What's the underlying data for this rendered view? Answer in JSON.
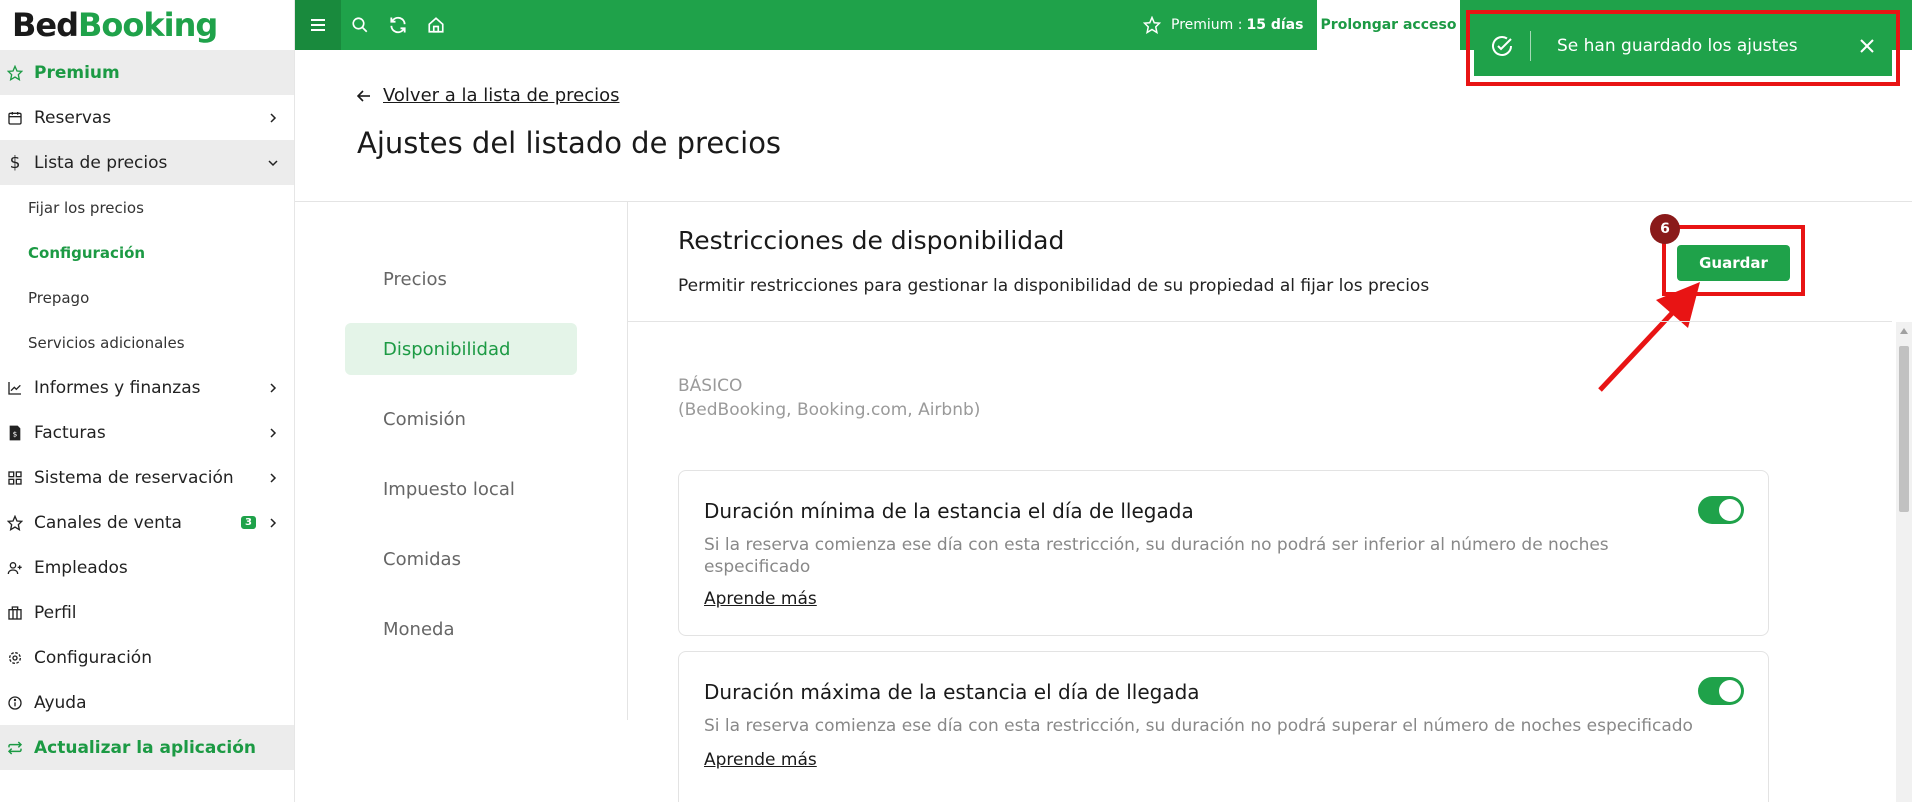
{
  "brand": {
    "part1": "Bed",
    "part2": "Booking"
  },
  "sidebar": {
    "items": [
      {
        "label": "Premium",
        "icon": "star-icon",
        "name": "sidebar-item-premium"
      },
      {
        "label": "Reservas",
        "icon": "calendar-icon",
        "name": "sidebar-item-reservas"
      },
      {
        "label": "Lista de precios",
        "icon": "dollar-icon",
        "name": "sidebar-item-lista-de-precios"
      },
      {
        "label": "Fijar los precios",
        "name": "sidebar-sub-fijar-precios"
      },
      {
        "label": "Configuración",
        "name": "sidebar-sub-configuracion"
      },
      {
        "label": "Prepago",
        "name": "sidebar-sub-prepago"
      },
      {
        "label": "Servicios adicionales",
        "name": "sidebar-sub-servicios-adicionales"
      },
      {
        "label": "Informes y finanzas",
        "icon": "chart-icon",
        "name": "sidebar-item-informes"
      },
      {
        "label": "Facturas",
        "icon": "invoice-icon",
        "name": "sidebar-item-facturas"
      },
      {
        "label": "Sistema de reservación",
        "icon": "grid-icon",
        "name": "sidebar-item-sistema"
      },
      {
        "label": "Canales de venta",
        "icon": "star-icon",
        "badge": "3",
        "name": "sidebar-item-canales"
      },
      {
        "label": "Empleados",
        "icon": "user-add-icon",
        "name": "sidebar-item-empleados"
      },
      {
        "label": "Perfil",
        "icon": "building-icon",
        "name": "sidebar-item-perfil"
      },
      {
        "label": "Configuración",
        "icon": "gear-icon",
        "name": "sidebar-item-configuracion"
      },
      {
        "label": "Ayuda",
        "icon": "info-icon",
        "name": "sidebar-item-ayuda"
      },
      {
        "label": "Actualizar la aplicación",
        "icon": "refresh-icon",
        "name": "sidebar-item-actualizar"
      }
    ]
  },
  "topbar": {
    "premium_label": "Premium :",
    "premium_days": "15 días",
    "prolongar": "Prolongar acceso"
  },
  "toast": {
    "message": "Se han guardado los ajustes"
  },
  "header": {
    "back_link": "Volver a la lista de precios",
    "title": "Ajustes del listado de precios"
  },
  "subnav": [
    "Precios",
    "Disponibilidad",
    "Comisión",
    "Impuesto local",
    "Comidas",
    "Moneda"
  ],
  "section": {
    "title": "Restricciones de disponibilidad",
    "description": "Permitir restricciones para gestionar la disponibilidad de su propiedad al fijar los precios",
    "save_label": "Guardar",
    "step_number": "6"
  },
  "group": {
    "label": "BÁSICO",
    "channels": "(BedBooking, Booking.com, Airbnb)"
  },
  "cards": [
    {
      "title": "Duración mínima de la estancia el día de llegada",
      "description": "Si la reserva comienza ese día con esta restricción, su duración no podrá ser inferior al número de noches especificado",
      "link": "Aprende más",
      "enabled": true
    },
    {
      "title": "Duración máxima de la estancia el día de llegada",
      "description": "Si la reserva comienza ese día con esta restricción, su duración no podrá superar el número de noches especificado",
      "link": "Aprende más",
      "enabled": true
    }
  ],
  "colors": {
    "brand_green": "#1fa24a",
    "highlight_red": "#e81414"
  }
}
